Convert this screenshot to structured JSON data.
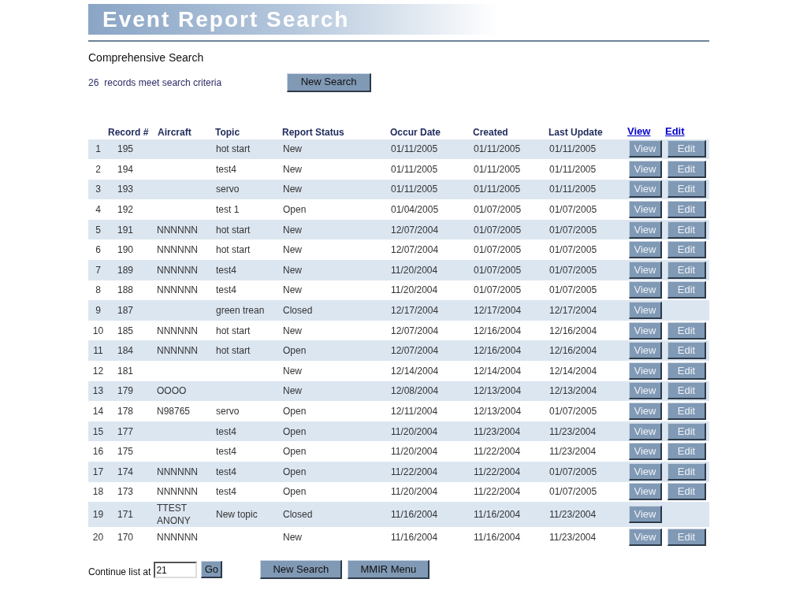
{
  "title": "Event Report Search",
  "subtitle": "Comprehensive Search",
  "summary": {
    "count": "26",
    "label": "records meet search criteria",
    "button": "New Search"
  },
  "table": {
    "columns": [
      {
        "kind": "blank"
      },
      {
        "kind": "text",
        "label": "Record #"
      },
      {
        "kind": "text",
        "label": "Aircraft"
      },
      {
        "kind": "text",
        "label": "Topic"
      },
      {
        "kind": "text",
        "label": "Report Status"
      },
      {
        "kind": "text",
        "label": "Occur Date"
      },
      {
        "kind": "text",
        "label": "Created"
      },
      {
        "kind": "text",
        "label": "Last Update"
      },
      {
        "kind": "link",
        "label": "View"
      },
      {
        "kind": "link",
        "label": "Edit"
      }
    ],
    "rows": [
      {
        "no": "1",
        "record": "195",
        "topic": "hot start",
        "status": "New",
        "occur": "01/11/2005",
        "created": "01/11/2005",
        "updated": "01/11/2005",
        "actions": [
          "View",
          "Edit"
        ]
      },
      {
        "no": "2",
        "record": "194",
        "topic": "test4",
        "status": "New",
        "occur": "01/11/2005",
        "created": "01/11/2005",
        "updated": "01/11/2005",
        "actions": [
          "View",
          "Edit"
        ]
      },
      {
        "no": "3",
        "record": "193",
        "topic": "servo",
        "status": "New",
        "occur": "01/11/2005",
        "created": "01/11/2005",
        "updated": "01/11/2005",
        "actions": [
          "View",
          "Edit"
        ]
      },
      {
        "no": "4",
        "record": "192",
        "topic": "test 1",
        "status": "Open",
        "occur": "01/04/2005",
        "created": "01/07/2005",
        "updated": "01/07/2005",
        "actions": [
          "View",
          "Edit"
        ]
      },
      {
        "no": "5",
        "record": "191",
        "aircraft": "NNNNNN",
        "topic": "hot start",
        "status": "New",
        "occur": "12/07/2004",
        "created": "01/07/2005",
        "updated": "01/07/2005",
        "actions": [
          "View",
          "Edit"
        ]
      },
      {
        "no": "6",
        "record": "190",
        "aircraft": "NNNNNN",
        "topic": "hot start",
        "status": "New",
        "occur": "12/07/2004",
        "created": "01/07/2005",
        "updated": "01/07/2005",
        "actions": [
          "View",
          "Edit"
        ]
      },
      {
        "no": "7",
        "record": "189",
        "aircraft": "NNNNNN",
        "topic": "test4",
        "status": "New",
        "occur": "11/20/2004",
        "created": "01/07/2005",
        "updated": "01/07/2005",
        "actions": [
          "View",
          "Edit"
        ]
      },
      {
        "no": "8",
        "record": "188",
        "aircraft": "NNNNNN",
        "topic": "test4",
        "status": "New",
        "occur": "11/20/2004",
        "created": "01/07/2005",
        "updated": "01/07/2005",
        "actions": [
          "View",
          "Edit"
        ]
      },
      {
        "no": "9",
        "record": "187",
        "topic": "green trean",
        "status": "Closed",
        "occur": "12/17/2004",
        "created": "12/17/2004",
        "updated": "12/17/2004",
        "actions": [
          "View"
        ]
      },
      {
        "no": "10",
        "record": "185",
        "aircraft": "NNNNNN",
        "topic": "hot start",
        "status": "New",
        "occur": "12/07/2004",
        "created": "12/16/2004",
        "updated": "12/16/2004",
        "actions": [
          "View",
          "Edit"
        ]
      },
      {
        "no": "11",
        "record": "184",
        "aircraft": "NNNNNN",
        "topic": "hot start",
        "status": "Open",
        "occur": "12/07/2004",
        "created": "12/16/2004",
        "updated": "12/16/2004",
        "actions": [
          "View",
          "Edit"
        ]
      },
      {
        "no": "12",
        "record": "181",
        "status": "New",
        "occur": "12/14/2004",
        "created": "12/14/2004",
        "updated": "12/14/2004",
        "actions": [
          "View",
          "Edit"
        ]
      },
      {
        "no": "13",
        "record": "179",
        "aircraft": "OOOO",
        "status": "New",
        "occur": "12/08/2004",
        "created": "12/13/2004",
        "updated": "12/13/2004",
        "actions": [
          "View",
          "Edit"
        ]
      },
      {
        "no": "14",
        "record": "178",
        "aircraft": "N98765",
        "topic": "servo",
        "status": "Open",
        "occur": "12/11/2004",
        "created": "12/13/2004",
        "updated": "01/07/2005",
        "actions": [
          "View",
          "Edit"
        ]
      },
      {
        "no": "15",
        "record": "177",
        "topic": "test4",
        "status": "Open",
        "occur": "11/20/2004",
        "created": "11/23/2004",
        "updated": "11/23/2004",
        "actions": [
          "View",
          "Edit"
        ]
      },
      {
        "no": "16",
        "record": "175",
        "topic": "test4",
        "status": "Open",
        "occur": "11/20/2004",
        "created": "11/22/2004",
        "updated": "11/23/2004",
        "actions": [
          "View",
          "Edit"
        ]
      },
      {
        "no": "17",
        "record": "174",
        "aircraft": "NNNNNN",
        "topic": "test4",
        "status": "Open",
        "occur": "11/22/2004",
        "created": "11/22/2004",
        "updated": "01/07/2005",
        "actions": [
          "View",
          "Edit"
        ]
      },
      {
        "no": "18",
        "record": "173",
        "aircraft": "NNNNNN",
        "topic": "test4",
        "status": "Open",
        "occur": "11/20/2004",
        "created": "11/22/2004",
        "updated": "01/07/2005",
        "actions": [
          "View",
          "Edit"
        ]
      },
      {
        "no": "19",
        "record": "171",
        "aircraft": "TTEST ANONY",
        "topic": "New topic",
        "status": "Closed",
        "occur": "11/16/2004",
        "created": "11/16/2004",
        "updated": "11/23/2004",
        "actions": [
          "View"
        ]
      },
      {
        "no": "20",
        "record": "170",
        "aircraft": "NNNNNN",
        "status": "New",
        "occur": "11/16/2004",
        "created": "11/16/2004",
        "updated": "11/23/2004",
        "actions": [
          "View",
          "Edit"
        ]
      }
    ]
  },
  "footer": {
    "label": "Continue list at",
    "value": "21",
    "go": "Go",
    "buttons": [
      "New Search",
      "MMIR Menu"
    ]
  }
}
